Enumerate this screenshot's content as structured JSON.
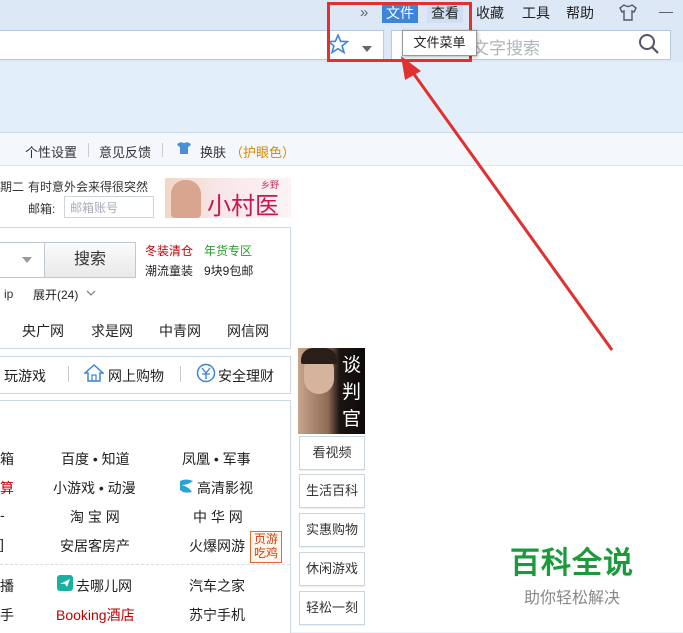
{
  "menu": {
    "overflow_label": "»",
    "items": [
      "文件",
      "查看",
      "收藏",
      "工具",
      "帮助"
    ],
    "minimize_label": "—"
  },
  "tooltip": "文件菜单",
  "search": {
    "placeholder": "文字搜索"
  },
  "settings": {
    "personal": "个性设置",
    "feedback": "意见反馈",
    "skin": "换肤",
    "eye_care": "（护眼色）"
  },
  "top_info": {
    "day_fragment": "期二",
    "slogan": "有时意外会来得很突然",
    "mail_label": "邮箱:",
    "mail_placeholder": "邮箱账号",
    "ad_top": "乡野",
    "ad_title": "小村医"
  },
  "search_box": {
    "button": "搜索",
    "promo1_a": "冬装清仓",
    "promo1_b": "年货专区",
    "promo2_a": "潮流童装",
    "promo2_b": "9块9包邮",
    "ip_text": "ip",
    "expand": "展开(24)"
  },
  "news_links": [
    "央广网",
    "求是网",
    "中青网",
    "网信网"
  ],
  "quick_links": [
    "玩游戏",
    "网上购物",
    "安全理财"
  ],
  "site_grid": [
    [
      "箱",
      "百度 • 知道",
      "凤凰 • 军事"
    ],
    [
      "算",
      "小游戏 • 动漫",
      "高清影视"
    ],
    [
      "-",
      "淘 宝 网",
      "中 华 网"
    ],
    [
      "]",
      "安居客房产",
      "火爆网游"
    ],
    [
      "播",
      "去哪儿网",
      "汽车之家"
    ],
    [
      "手",
      "Booking酒店",
      "苏宁手机"
    ]
  ],
  "game_badge": [
    "页游",
    "吃鸡"
  ],
  "side_ad_text": [
    "谈",
    "判",
    "官"
  ],
  "side_buttons": [
    "看视频",
    "生活百科",
    "实惠购物",
    "休闲游戏",
    "轻松一刻"
  ],
  "watermark": {
    "title": "百科全说",
    "subtitle": "助你轻松解决"
  },
  "colors": {
    "accent": "#3b86d8",
    "annotation": "#e03030",
    "watermark": "#1a9a3a"
  }
}
